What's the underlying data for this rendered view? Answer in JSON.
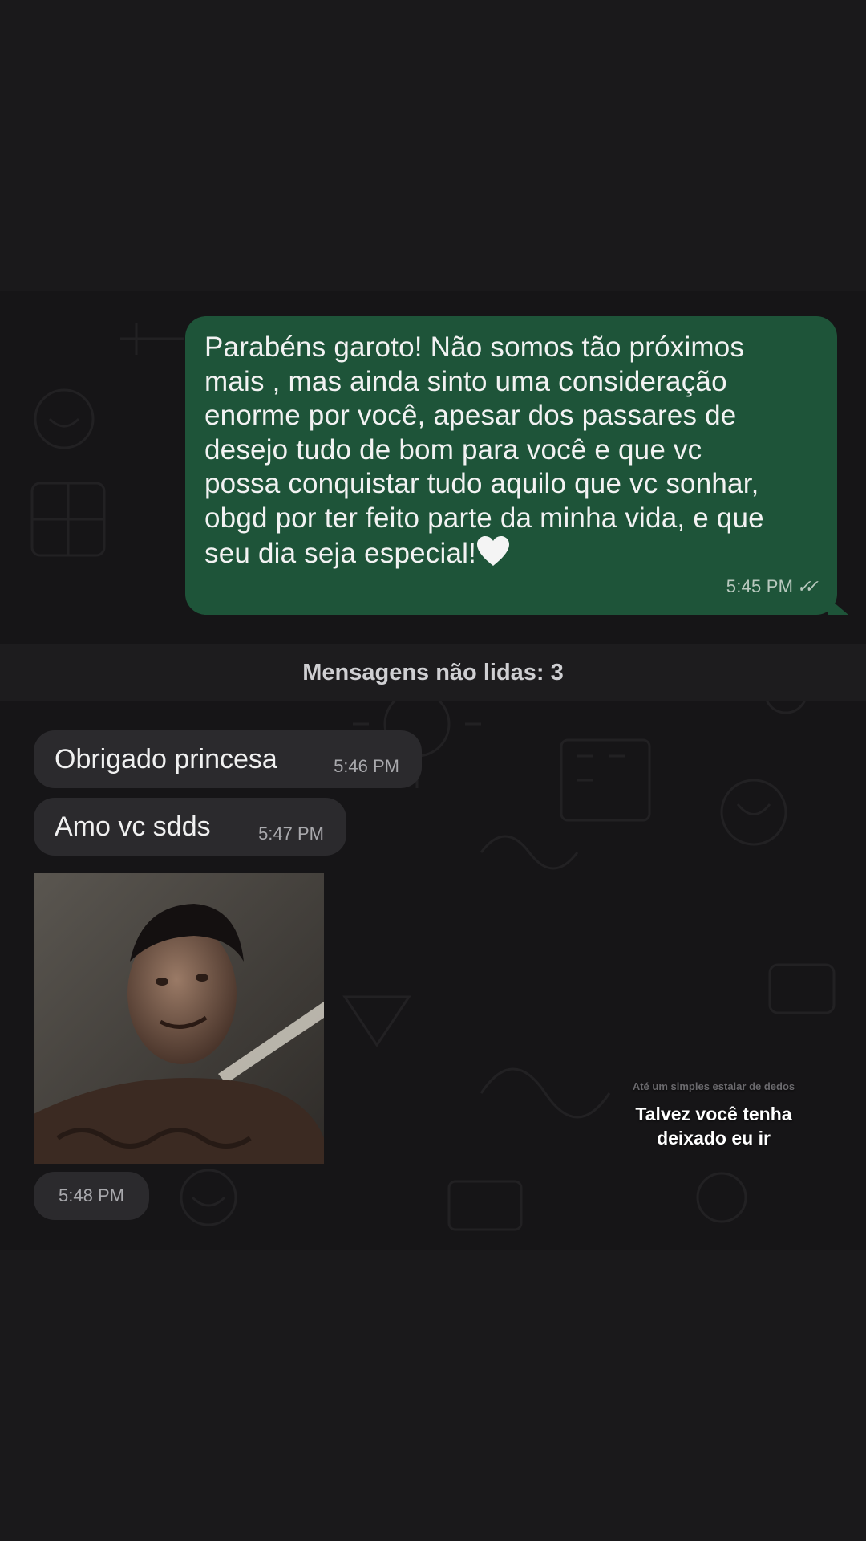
{
  "sent_message": {
    "text": "Parabéns garoto! Não somos tão próximos\nmais , mas ainda sinto uma consideração\nenorme por você, apesar dos passares de\ndesejo tudo de bom para você e que vc\npossa conquistar tudo aquilo que vc sonhar,\nobgd por ter feito parte da minha vida, e que\nseu dia seja especial!",
    "emoji": "white-heart",
    "time": "5:45 PM",
    "status_icon": "double-check-read",
    "colors": {
      "bubble": "#1e5439"
    }
  },
  "unread_divider": {
    "label": "Mensagens não lidas: 3"
  },
  "received_messages": [
    {
      "text": "Obrigado princesa",
      "time": "5:46 PM"
    },
    {
      "text": "Amo vc sdds",
      "time": "5:47 PM"
    }
  ],
  "photo_message": {
    "time": "5:48 PM"
  },
  "story_caption": {
    "small_text": "Até um simples estalar de dedos",
    "text": "Talvez você tenha deixado eu ir"
  }
}
